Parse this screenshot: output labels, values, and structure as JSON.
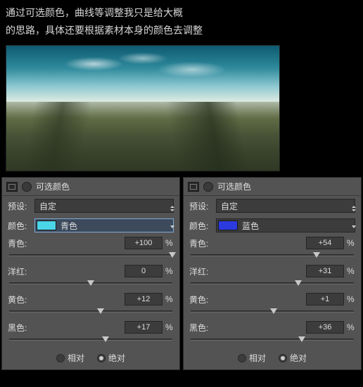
{
  "caption": {
    "line1": "通过可选颜色，曲线等调整我只是给大概",
    "line2": "的思路，具体还要根据素材本身的颜色去调整"
  },
  "panel_title": "可选颜色",
  "labels": {
    "preset": "预设:",
    "color": "颜色:",
    "cyan": "青色:",
    "magenta": "洋红:",
    "yellow": "黄色:",
    "black": "黑色:",
    "pct": "%",
    "relative": "相对",
    "absolute": "绝对"
  },
  "left": {
    "preset_value": "自定",
    "color_name": "青色",
    "swatch": "#4bd5e8",
    "highlight": true,
    "sliders": {
      "cyan": {
        "value": "+100",
        "pos": 100
      },
      "magenta": {
        "value": "0",
        "pos": 50
      },
      "yellow": {
        "value": "+12",
        "pos": 56
      },
      "black": {
        "value": "+17",
        "pos": 59
      }
    },
    "mode": "absolute"
  },
  "right": {
    "preset_value": "自定",
    "color_name": "蓝色",
    "swatch": "#2b3be0",
    "highlight": false,
    "sliders": {
      "cyan": {
        "value": "+54",
        "pos": 77
      },
      "magenta": {
        "value": "+31",
        "pos": 66
      },
      "yellow": {
        "value": "+1",
        "pos": 51
      },
      "black": {
        "value": "+36",
        "pos": 68
      }
    },
    "mode": "absolute"
  }
}
